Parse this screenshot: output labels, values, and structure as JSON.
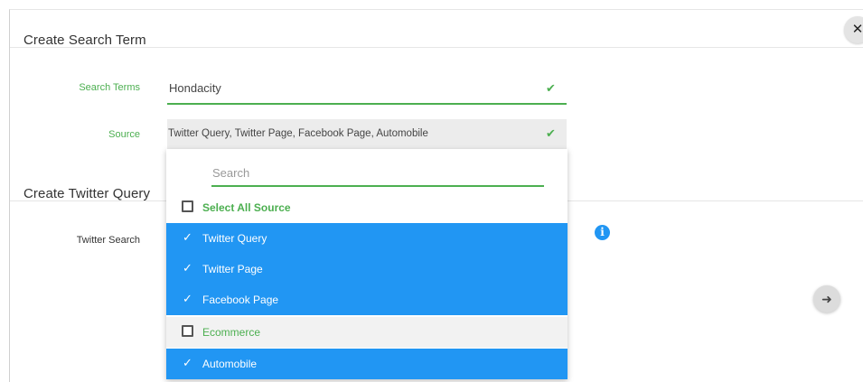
{
  "modal": {
    "close_icon": "close-icon",
    "create_search_term_title": "Create Search Term",
    "create_twitter_query_title": "Create Twitter Query"
  },
  "form": {
    "search_terms_label": "Search Terms",
    "search_terms_value": "Hondacity",
    "source_label": "Source",
    "source_value": "Twitter Query, Twitter Page, Facebook Page, Automobile",
    "twitter_search_label": "Twitter Search"
  },
  "dropdown": {
    "search_placeholder": "Search",
    "select_all_label": "Select All Source",
    "options": [
      {
        "label": "Twitter Query",
        "selected": true
      },
      {
        "label": "Twitter Page",
        "selected": true
      },
      {
        "label": "Facebook Page",
        "selected": true
      },
      {
        "label": "Ecommerce",
        "selected": false
      },
      {
        "label": "Automobile",
        "selected": true
      }
    ]
  },
  "colors": {
    "accent_green": "#4caf50",
    "selected_blue": "#2196f3"
  },
  "icons": {
    "info": "info-icon",
    "next": "arrow-right-icon",
    "check": "check-icon"
  }
}
